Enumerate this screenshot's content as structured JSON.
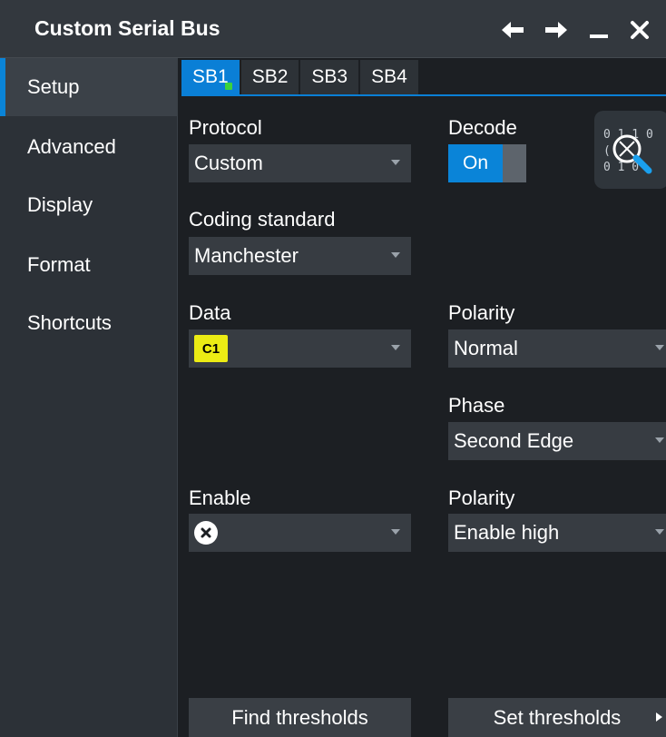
{
  "window": {
    "title": "Custom Serial Bus",
    "icons": [
      "arrow-left-icon",
      "arrow-right-icon",
      "minimize-icon",
      "close-icon"
    ]
  },
  "sidebar": {
    "items": [
      {
        "label": "Setup",
        "active": true
      },
      {
        "label": "Advanced",
        "active": false
      },
      {
        "label": "Display",
        "active": false
      },
      {
        "label": "Format",
        "active": false
      },
      {
        "label": "Shortcuts",
        "active": false
      }
    ]
  },
  "tabs": [
    {
      "label": "SB1",
      "active": true,
      "status": "on"
    },
    {
      "label": "SB2",
      "active": false
    },
    {
      "label": "SB3",
      "active": false
    },
    {
      "label": "SB4",
      "active": false
    }
  ],
  "setup": {
    "protocol": {
      "label": "Protocol",
      "value": "Custom"
    },
    "decode": {
      "label": "Decode",
      "state": "On",
      "icon": "decode-search-icon"
    },
    "coding_standard": {
      "label": "Coding standard",
      "value": "Manchester"
    },
    "data": {
      "label": "Data",
      "source": "C1",
      "source_color": "#ecec14"
    },
    "data_polarity": {
      "label": "Polarity",
      "value": "Normal"
    },
    "phase": {
      "label": "Phase",
      "value": "Second Edge"
    },
    "enable": {
      "label": "Enable",
      "value_icon": "disabled-x-icon"
    },
    "enable_polarity": {
      "label": "Polarity",
      "value": "Enable high"
    }
  },
  "buttons": {
    "find_thresholds": "Find thresholds",
    "set_thresholds": "Set thresholds"
  },
  "colors": {
    "accent": "#0a84d8",
    "status_green": "#3cd33c",
    "background": "#1c1f23",
    "sidebar": "#2c3137"
  }
}
